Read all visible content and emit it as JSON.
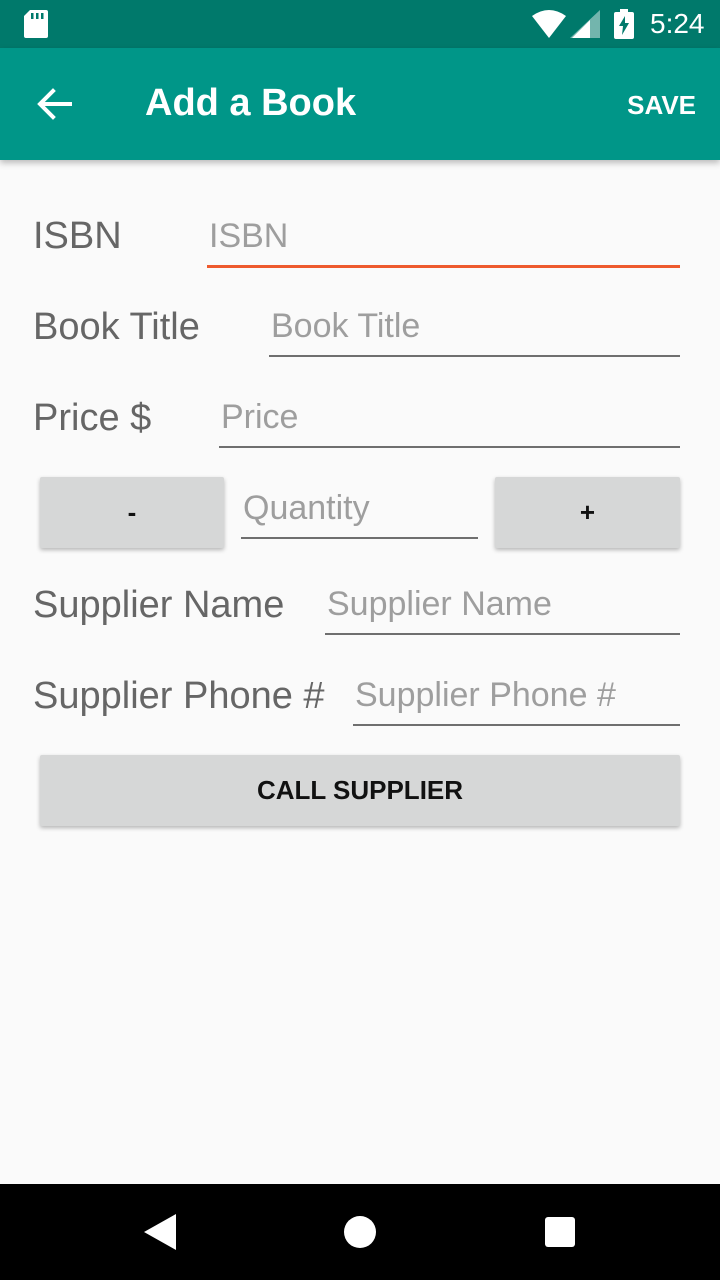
{
  "status_bar": {
    "time": "5:24",
    "icons": [
      "sd-card-icon",
      "wifi-icon",
      "signal-icon",
      "battery-charging-icon"
    ]
  },
  "app_bar": {
    "title": "Add a Book",
    "save_label": "SAVE",
    "back_icon": "arrow-back-icon"
  },
  "form": {
    "isbn": {
      "label": "ISBN",
      "placeholder": "ISBN",
      "value": ""
    },
    "book_title": {
      "label": "Book Title",
      "placeholder": "Book Title",
      "value": ""
    },
    "price": {
      "label": "Price $",
      "placeholder": "Price",
      "value": ""
    },
    "quantity": {
      "placeholder": "Quantity",
      "value": "",
      "decrement_label": "-",
      "increment_label": "+"
    },
    "supplier_name": {
      "label": "Supplier Name",
      "placeholder": "Supplier Name",
      "value": ""
    },
    "supplier_phone": {
      "label": "Supplier Phone #",
      "placeholder": "Supplier Phone #",
      "value": ""
    },
    "call_supplier_label": "CALL SUPPLIER"
  },
  "colors": {
    "status_bar": "#00796b",
    "app_bar": "#009688",
    "focus_underline": "#ee5a2e",
    "button_bg": "#d6d7d7"
  },
  "nav_bar": {
    "icons": [
      "nav-back-icon",
      "nav-home-icon",
      "nav-recents-icon"
    ]
  }
}
